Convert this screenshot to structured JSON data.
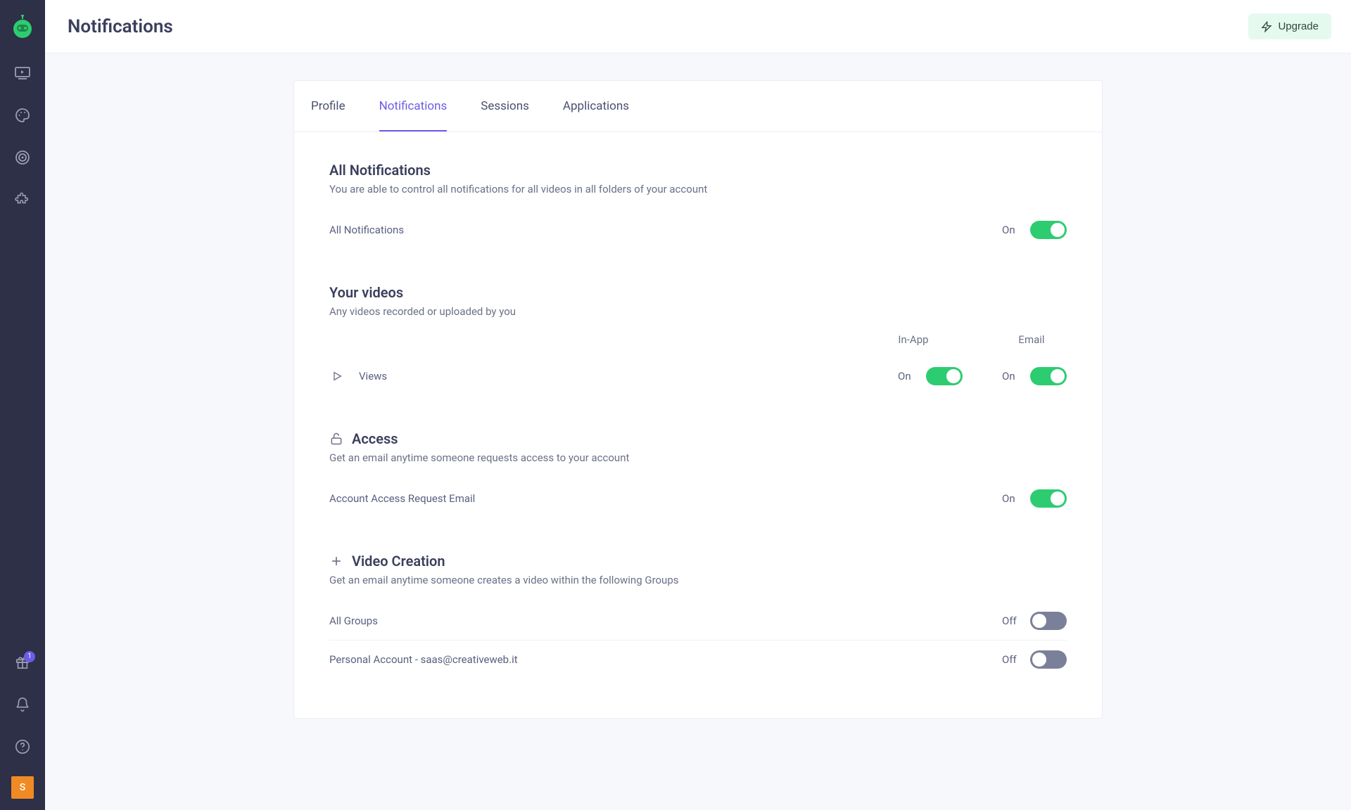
{
  "header": {
    "title": "Notifications",
    "upgrade_label": "Upgrade"
  },
  "sidebar": {
    "gift_badge": "1",
    "avatar_initial": "S"
  },
  "tabs": [
    {
      "label": "Profile",
      "active": false
    },
    {
      "label": "Notifications",
      "active": true
    },
    {
      "label": "Sessions",
      "active": false
    },
    {
      "label": "Applications",
      "active": false
    }
  ],
  "sections": {
    "all": {
      "title": "All Notifications",
      "desc": "You are able to control all notifications for all videos in all folders of your account",
      "row_label": "All Notifications",
      "state_label": "On",
      "state": true
    },
    "your_videos": {
      "title": "Your videos",
      "desc": "Any videos recorded or uploaded by you",
      "col_inapp": "In-App",
      "col_email": "Email",
      "row_label": "Views",
      "inapp_state_label": "On",
      "inapp_state": true,
      "email_state_label": "On",
      "email_state": true
    },
    "access": {
      "title": "Access",
      "desc": "Get an email anytime someone requests access to your account",
      "row_label": "Account Access Request Email",
      "state_label": "On",
      "state": true
    },
    "video_creation": {
      "title": "Video Creation",
      "desc": "Get an email anytime someone creates a video within the following Groups",
      "rows": [
        {
          "label": "All Groups",
          "state_label": "Off",
          "state": false
        },
        {
          "label": "Personal Account - saas@creativeweb.it",
          "state_label": "Off",
          "state": false
        }
      ]
    }
  }
}
